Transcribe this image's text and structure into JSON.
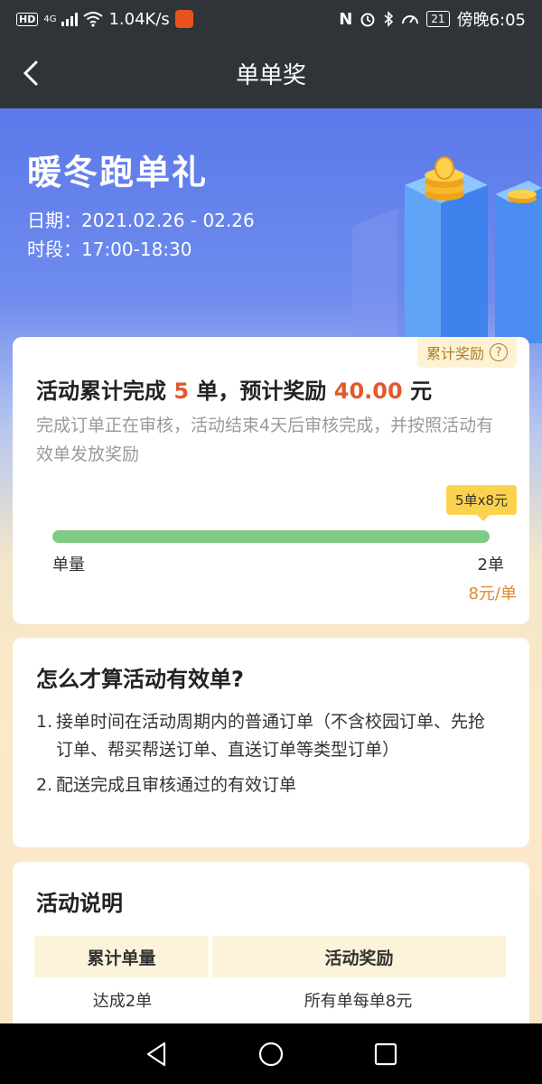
{
  "status_bar": {
    "hd": "HD",
    "network": "4G",
    "speed": "1.04K/s",
    "battery": "21",
    "time": "傍晚6:05",
    "icons": [
      "signal-icon",
      "wifi-icon",
      "nfc-icon",
      "alarm-icon",
      "bluetooth-icon",
      "speed-icon",
      "battery-icon"
    ]
  },
  "nav": {
    "title": "单单奖",
    "back_icon": "chevron-left-icon"
  },
  "hero": {
    "title": "暖冬跑单礼",
    "date_line": "日期：2021.02.26 - 02.26",
    "time_line": "时段：17:00-18:30"
  },
  "reward": {
    "help_badge": "累计奖励",
    "help_icon": "?",
    "head_prefix": "活动累计完成",
    "orders_done": "5",
    "head_mid": "单，预计奖励",
    "amount": "40.00",
    "head_suffix": "元",
    "description": "完成订单正在审核，活动结束4天后审核完成，并按照活动有效单发放奖励",
    "tooltip": "5单x8元",
    "progress_fraction": 1.0,
    "progress_left_label": "单量",
    "progress_right_label": "2单",
    "rate": "8元/单",
    "accent_color": "#e25a2c",
    "progress_color": "#7fca86"
  },
  "rules": {
    "title": "怎么才算活动有效单?",
    "items": [
      {
        "num": "1.",
        "text": "接单时间在活动周期内的普通订单（不含校园订单、先抢订单、帮买帮送订单、直送订单等类型订单）"
      },
      {
        "num": "2.",
        "text": "配送完成且审核通过的有效订单"
      }
    ]
  },
  "info": {
    "title": "活动说明",
    "headers": [
      "累计单量",
      "活动奖励"
    ],
    "rows": [
      [
        "达成2单",
        "所有单每单8元"
      ]
    ]
  },
  "system_nav": [
    "back-triangle-icon",
    "home-circle-icon",
    "recents-square-icon"
  ]
}
